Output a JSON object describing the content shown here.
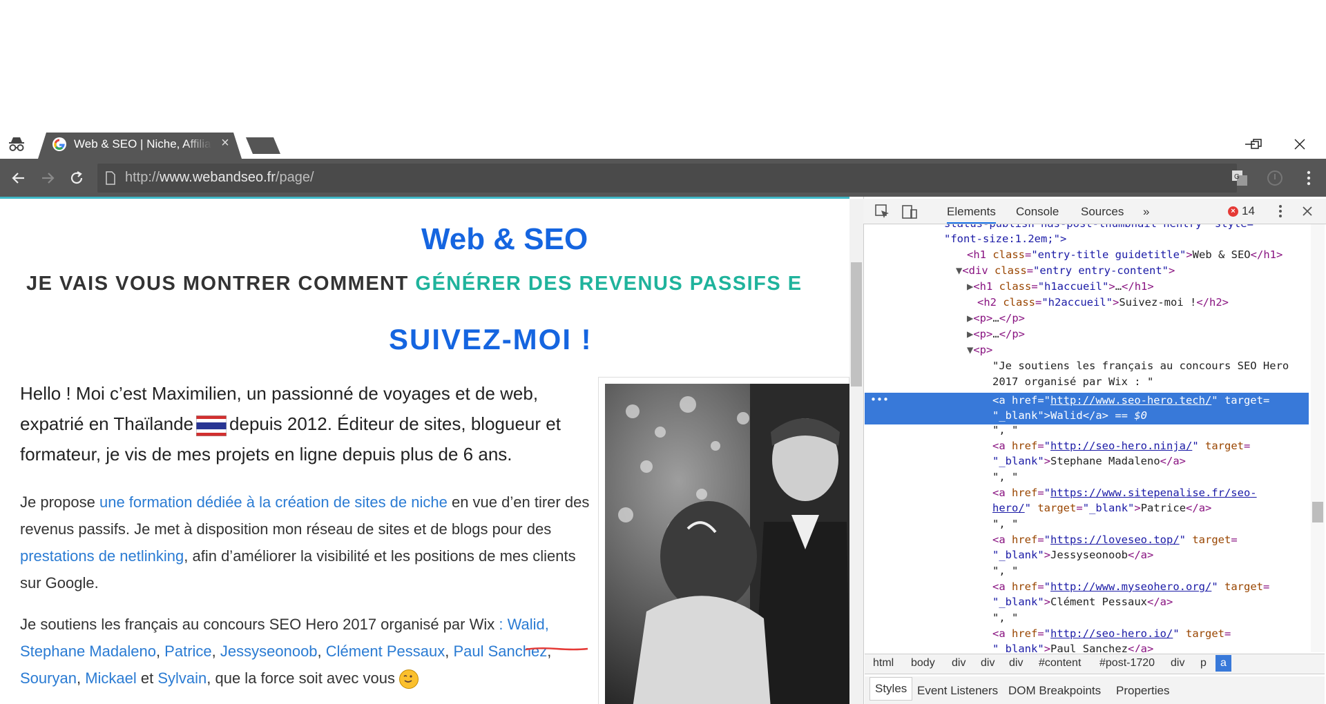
{
  "browser": {
    "tab_title": "Web & SEO | Niche, Affiliation",
    "tab_close": "×",
    "url_prefix": "http://",
    "url_domain": "www.webandseo.fr",
    "url_path": "/page/"
  },
  "page": {
    "site_title": "Web & SEO",
    "tagline_dark": "JE VAIS VOUS MONTRER COMMENT ",
    "tagline_accent": "GÉNÉRER DES REVENUS PASSIFS E",
    "follow": "SUIVEZ-MOI !",
    "intro_part1": "Hello ! Moi c’est Maximilien, un passionné de voyages et de web, expatrié en Thaïlande",
    "intro_part2": "depuis 2012. Éditeur de sites, blogueur et formateur, je vis de mes projets en ligne depuis plus de 6 ans.",
    "p2_a": "Je propose ",
    "p2_link1": "une formation dédiée à la création de sites de niche",
    "p2_b": " en vue d’en tirer des revenus passifs. Je met à disposition mon réseau de sites et de blogs pour des ",
    "p2_link2": "prestations de netlinking",
    "p2_c": ", afin d’améliorer la visibilité et les positions de mes clients sur Google.",
    "p3_a": "Je soutiens les français au concours SEO Hero 2017 organisé par Wix ",
    "p3_walid": ": Walid,",
    "p3_l1": "Stephane Madaleno",
    "p3_l2": "Patrice",
    "p3_l3": "Jessyseonoob",
    "p3_l4": "Clément Pessaux",
    "p3_l5": "Paul Sanchez",
    "p3_l6": "Souryan",
    "p3_l7": "Mickael",
    "p3_l8": "Sylvain",
    "p3_end": ", que la force soit avec vous",
    "comma": ", ",
    "and": " et "
  },
  "devtools": {
    "tabs": [
      "Elements",
      "Console",
      "Sources",
      "»"
    ],
    "error_count": "14",
    "crumbs": [
      "html",
      "body",
      "div",
      "div",
      "div",
      "#content",
      "#post-1720",
      "div",
      "p",
      "a"
    ],
    "subtabs": [
      "Styles",
      "Event Listeners",
      "DOM Breakpoints",
      "Properties"
    ],
    "lines": {
      "l0": "status-publish has-post-thumbnail hentry\" style=",
      "l1": "\"font-size:1.2em;\">",
      "h1_text": "Web & SEO",
      "h2_text": "Suivez-moi !",
      "quote1": "\"Je soutiens les français au concours SEO Hero",
      "quote2": "2017 organisé par Wix : \"",
      "sep": "\", \"",
      "ellipsis": "…",
      "a1_href": "http://www.seo-hero.tech/",
      "a1_text": "Walid",
      "a2_href": "http://seo-hero.ninja/",
      "a2_text": "Stephane Madaleno",
      "a3_href1": "https://www.sitepenalise.fr/seo-",
      "a3_href2": "hero/",
      "a3_text": "Patrice",
      "a4_href": "https://loveseo.top/",
      "a4_text": "Jessyseonoob",
      "a5_href": "http://www.myseohero.org/",
      "a5_text": "Clément Pessaux",
      "a6_href": "http://seo-hero.io/",
      "a6_text": "Paul Sanchez",
      "blank": "_blank",
      "eq": " == $0"
    }
  },
  "colors": {
    "link": "#2a7bd3",
    "title_blue": "#1565e0",
    "accent_teal": "#1fb39c",
    "selection": "#3879d9"
  }
}
